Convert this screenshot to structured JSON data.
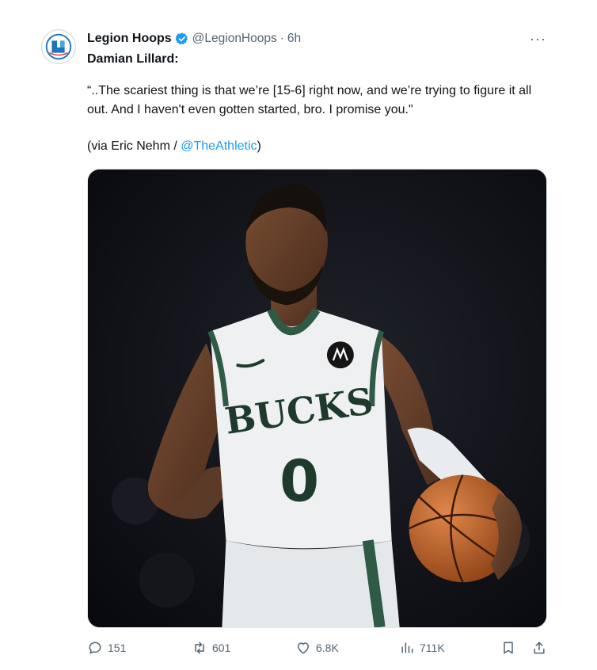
{
  "author": {
    "display_name": "Legion Hoops",
    "handle": "@LegionHoops",
    "separator": "·",
    "time": "6h",
    "avatar_icon": "legion-hoops-logo",
    "verified_icon": "verified-badge-icon",
    "verified_color": "#1d9bf0"
  },
  "more_label": "···",
  "tweet": {
    "line1": "Damian Lillard:",
    "quote": "“..The scariest thing is that we’re [15-6] right now, and we’re trying to figure it all out. And I haven't even gotten started, bro. I promise you.\"",
    "via_prefix": "(via Eric Nehm / ",
    "via_mention": "@TheAthletic",
    "via_suffix": ")",
    "mention_color": "#1d9bf0"
  },
  "media": {
    "jersey_text": "BUCKS",
    "jersey_number": "0"
  },
  "actions": {
    "replies": "151",
    "retweets": "601",
    "likes": "6.8K",
    "views": "711K",
    "reply_icon": "reply-icon",
    "retweet_icon": "retweet-icon",
    "like_icon": "heart-icon",
    "views_icon": "views-chart-icon",
    "bookmark_icon": "bookmark-icon",
    "share_icon": "share-icon"
  }
}
